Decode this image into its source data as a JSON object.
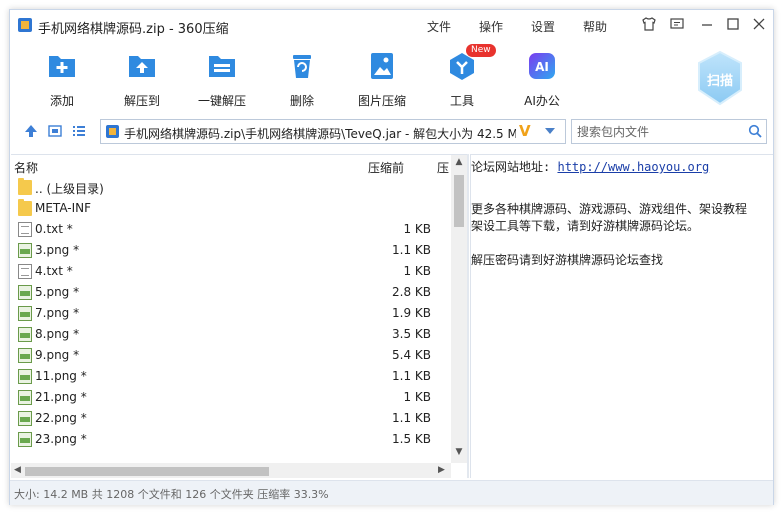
{
  "window": {
    "title": "手机网络棋牌源码.zip - 360压缩",
    "menu": [
      "文件",
      "操作",
      "设置",
      "帮助"
    ],
    "controls": [
      "shirt-icon",
      "chat-icon",
      "minimize-icon",
      "maximize-icon",
      "close-icon"
    ]
  },
  "toolbar": {
    "items": [
      {
        "label": "添加",
        "icon": "add-icon"
      },
      {
        "label": "解压到",
        "icon": "extract-to-icon"
      },
      {
        "label": "一键解压",
        "icon": "one-click-extract-icon"
      },
      {
        "label": "删除",
        "icon": "delete-icon"
      },
      {
        "label": "图片压缩",
        "icon": "image-compress-icon"
      },
      {
        "label": "工具",
        "icon": "tools-icon",
        "badge": "New"
      },
      {
        "label": "AI办公",
        "icon": "ai-office-icon",
        "icon_text": "AI"
      }
    ],
    "scan_label": "扫描"
  },
  "addressbar": {
    "path": "手机网络棋牌源码.zip\\手机网络棋牌源码\\TeveQ.jar - 解包大小为 42.5 M",
    "v_mark": "V",
    "search_placeholder": "搜索包内文件"
  },
  "filelist": {
    "columns": {
      "name": "名称",
      "size_before": "压缩前",
      "size_after": "压"
    },
    "rows": [
      {
        "name": ".. (上级目录)",
        "size": "",
        "type": "folder"
      },
      {
        "name": "META-INF",
        "size": "",
        "type": "folder"
      },
      {
        "name": "0.txt *",
        "size": "1 KB",
        "type": "txt"
      },
      {
        "name": "3.png *",
        "size": "1.1 KB",
        "type": "png"
      },
      {
        "name": "4.txt *",
        "size": "1 KB",
        "type": "txt"
      },
      {
        "name": "5.png *",
        "size": "2.8 KB",
        "type": "png"
      },
      {
        "name": "7.png *",
        "size": "1.9 KB",
        "type": "png"
      },
      {
        "name": "8.png *",
        "size": "3.5 KB",
        "type": "png"
      },
      {
        "name": "9.png *",
        "size": "5.4 KB",
        "type": "png"
      },
      {
        "name": "11.png *",
        "size": "1.1 KB",
        "type": "png"
      },
      {
        "name": "21.png *",
        "size": "1 KB",
        "type": "png"
      },
      {
        "name": "22.png *",
        "size": "1.1 KB",
        "type": "png"
      },
      {
        "name": "23.png *",
        "size": "1.5 KB",
        "type": "png"
      }
    ]
  },
  "comment": {
    "site_label": "论坛网站地址:",
    "site_url": "http://www.haoyou.org",
    "line2": "更多各种棋牌源码、游戏源码、游戏组件、架设教程",
    "line3": "架设工具等下载，请到好游棋牌源码论坛。",
    "line4": "解压密码请到好游棋牌源码论坛查找"
  },
  "status": {
    "text": "大小: 14.2 MB 共 1208 个文件和 126 个文件夹 压缩率 33.3%"
  },
  "colors": {
    "accent": "#2f8ae0",
    "status_bg": "#eef2f7"
  }
}
